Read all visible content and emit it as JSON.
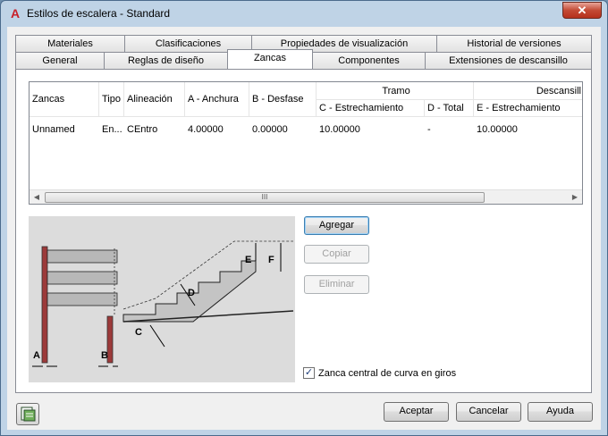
{
  "window": {
    "title": "Estilos de escalera - Standard",
    "close_glyph": "✕",
    "app_icon": "A"
  },
  "tabs_row1": [
    {
      "label": "Materiales"
    },
    {
      "label": "Clasificaciones"
    },
    {
      "label": "Propiedades de visualización"
    },
    {
      "label": "Historial de versiones"
    }
  ],
  "tabs_row2": [
    {
      "label": "General"
    },
    {
      "label": "Reglas de diseño"
    },
    {
      "label": "Zancas",
      "active": true
    },
    {
      "label": "Componentes"
    },
    {
      "label": "Extensiones de descansillo"
    }
  ],
  "grid": {
    "columns": {
      "zancas": "Zancas",
      "tipo": "Tipo",
      "alineacion": "Alineación",
      "a_anchura": "A - Anchura",
      "b_desfase": "B - Desfase",
      "tramo_group": "Tramo",
      "c_estrechamiento": "C - Estrechamiento",
      "d_total": "D - Total",
      "descansillo_group": "Descansill",
      "e_estrechamiento": "E - Estrechamiento"
    },
    "rows": [
      {
        "zancas": "Unnamed",
        "tipo": "En...",
        "alineacion": "CEntro",
        "a_anchura": "4.00000",
        "b_desfase": "0.00000",
        "c_estrechamiento": "10.00000",
        "d_total": "-",
        "e_estrechamiento": "10.00000"
      }
    ],
    "scroll_left": "◀",
    "scroll_right": "▶",
    "scroll_grip": "III"
  },
  "diagram": {
    "labels": {
      "a": "A",
      "b": "B",
      "c": "C",
      "d": "D",
      "e": "E",
      "f": "F"
    }
  },
  "buttons": {
    "agregar": "Agregar",
    "copiar": "Copiar",
    "eliminar": "Eliminar",
    "aceptar": "Aceptar",
    "cancelar": "Cancelar",
    "ayuda": "Ayuda"
  },
  "checkbox": {
    "label": "Zanca central de curva en giros",
    "checked": true,
    "check_glyph": "✓"
  },
  "colors": {
    "title_bar": "#bfd3e6",
    "close_button": "#c44a35",
    "focus_border": "#3c7fb1"
  },
  "icons": {
    "bottom_left_button": "style-browser-icon"
  }
}
